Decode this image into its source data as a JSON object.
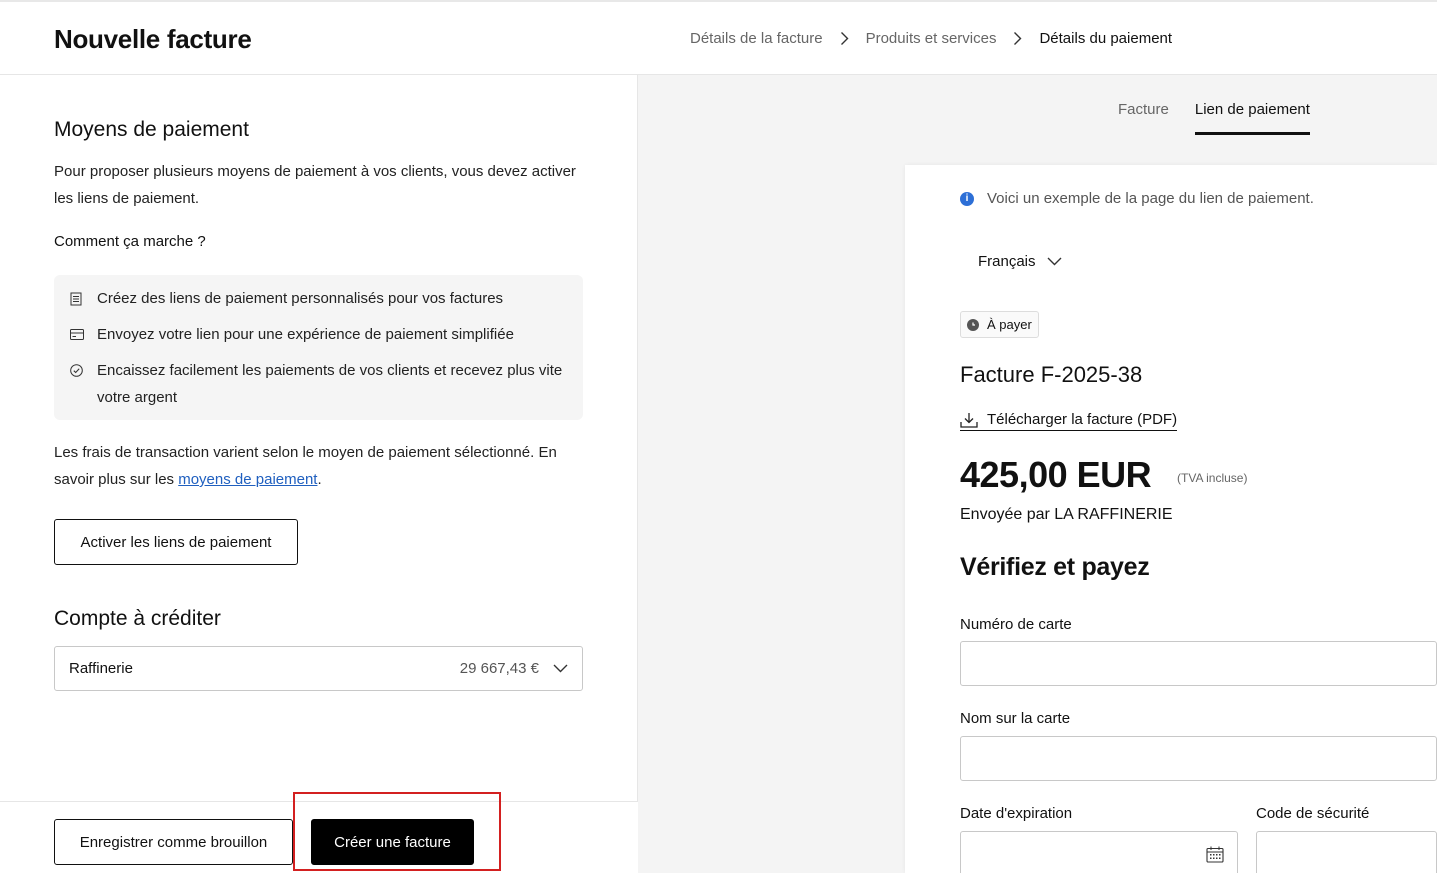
{
  "header": {
    "title": "Nouvelle facture",
    "breadcrumb": [
      "Détails de la facture",
      "Produits et services",
      "Détails du paiement"
    ]
  },
  "left": {
    "payment_methods": {
      "title": "Moyens de paiement",
      "intro": "Pour proposer plusieurs moyens de paiement à vos clients, vous devez activer les liens de paiement.",
      "how_title": "Comment ça marche ?",
      "steps": [
        {
          "icon": "document-icon",
          "text": "Créez des liens de paiement personnalisés pour vos factures"
        },
        {
          "icon": "card-icon",
          "text": "Envoyez votre lien pour une expérience de paiement simplifiée"
        },
        {
          "icon": "check-circle-icon",
          "text": "Encaissez facilement les paiements de vos clients et recevez plus vite votre argent"
        }
      ],
      "fees_text": "Les frais de transaction varient selon le moyen de paiement sélectionné. En savoir plus sur les ",
      "fees_link": "moyens de paiement",
      "fees_end": ".",
      "activate_button": "Activer les liens de paiement"
    },
    "account": {
      "title": "Compte à créditer",
      "name": "Raffinerie",
      "balance": "29 667,43 €"
    },
    "footer": {
      "draft_button": "Enregistrer comme brouillon",
      "create_button": "Créer une facture"
    }
  },
  "right": {
    "tabs": [
      "Facture",
      "Lien de paiement"
    ],
    "active_tab": "Lien de paiement",
    "preview": {
      "notice": "Voici un exemple de la page du lien de paiement.",
      "language": "Français",
      "status": "À payer",
      "invoice_title": "Facture F-2025-38",
      "download": "Télécharger la facture (PDF)",
      "amount": "425,00 EUR",
      "tva": "(TVA incluse)",
      "sender": "Envoyée par LA RAFFINERIE",
      "verify_title": "Vérifiez et payez",
      "fields": {
        "card_number": "Numéro de carte",
        "card_name": "Nom sur la carte",
        "expiry": "Date d'expiration",
        "cvc": "Code de sécurité"
      }
    }
  },
  "colors": {
    "accent_link": "#1f5fbf",
    "info_icon": "#2d6fd6",
    "highlight": "#d32020"
  }
}
